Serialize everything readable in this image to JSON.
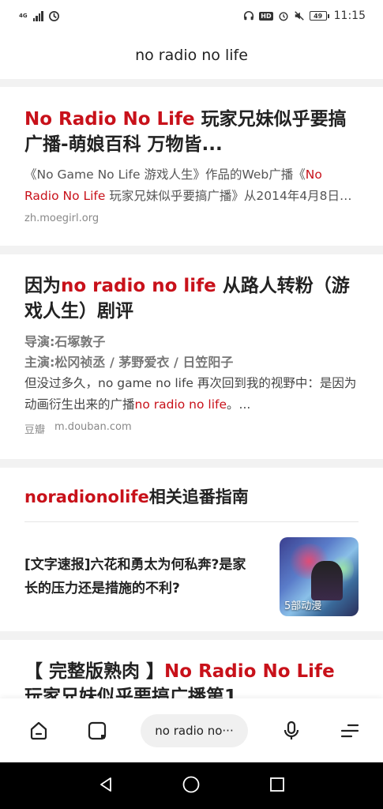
{
  "status_bar": {
    "network_top": "4G",
    "network_bottom": "ull",
    "hd_badge": "HD",
    "battery": "49",
    "time": "11:15"
  },
  "title_bar": {
    "query": "no radio no life"
  },
  "result1": {
    "title_highlight": "No Radio No Life",
    "title_rest": " 玩家兄妹似乎要搞广播-萌娘百科 万物皆...",
    "snippet_pre": "《No Game No Life 游戏人生》作品的Web广播《",
    "snippet_highlight": "No Radio No Life",
    "snippet_post": " 玩家兄妹似乎要搞广播》从2014年4月8日…",
    "source": "zh.moegirl.org"
  },
  "result2": {
    "title_pre": "因为",
    "title_highlight": "no radio no life",
    "title_post": " 从路人转粉（游戏人生）剧评",
    "director": "导演:石塚敦子",
    "cast": "主演:松冈祯丞 / 茅野爱衣 / 日笠阳子",
    "snippet_pre": "但没过多久，no game no life 再次回到我的视野中：是因为动画衍生出来的广播",
    "snippet_highlight": "no radio no life",
    "snippet_post": "。...",
    "source_name": "豆瓣",
    "source_url": "m.douban.com"
  },
  "related": {
    "title_highlight": "noradionolife",
    "title_rest": "相关追番指南",
    "item_text": "[文字速报]六花和勇太为何私奔?是家长的压力还是措施的不利?",
    "thumb_caption": "5部动漫"
  },
  "result4": {
    "title_pre": "【 完整版熟肉 】",
    "title_highlight": "No Radio No Life",
    "title_post": " 玩家兄妹似乎要搞广播第1"
  },
  "bottom_bar": {
    "search_text": "no radio no···"
  },
  "colors": {
    "highlight": "#c8111a",
    "background": "#f2f2f2"
  }
}
